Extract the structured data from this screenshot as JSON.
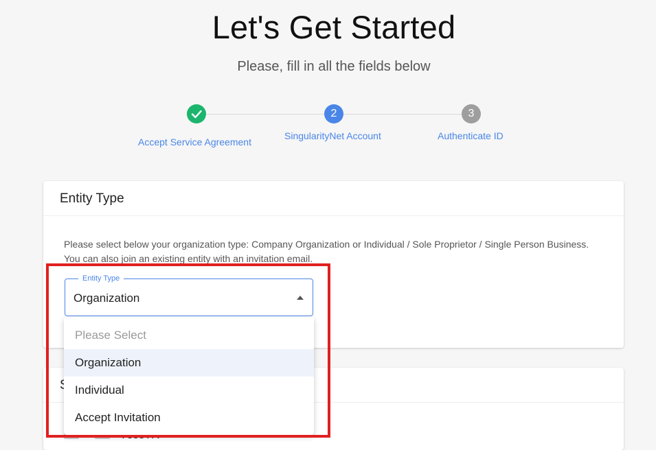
{
  "header": {
    "title": "Let's Get Started",
    "subtitle": "Please, fill in all the fields below"
  },
  "stepper": {
    "steps": [
      {
        "label": "Accept Service Agreement",
        "number": "",
        "state": "completed",
        "icon": "check-icon",
        "color": "#1cb56d"
      },
      {
        "label": "SingularityNet Account",
        "number": "2",
        "state": "active",
        "color": "#4a86e8"
      },
      {
        "label": "Authenticate ID",
        "number": "3",
        "state": "pending",
        "color": "#9e9e9e"
      }
    ]
  },
  "entity_card": {
    "title": "Entity Type",
    "description_line1": "Please select below your organization type: Company Organization or Individual / Sole Proprietor / Single Person Business.",
    "description_line2": "You can also join an existing entity with an invitation email.",
    "select": {
      "label": "Entity Type",
      "value": "Organization",
      "options": [
        "Please Select",
        "Organization",
        "Individual",
        "Accept Invitation"
      ],
      "placeholder_index": 0,
      "selected_index": 1
    }
  },
  "second_card": {
    "title_partial": "S",
    "content_partial": "?cco?r?"
  },
  "colors": {
    "accent": "#4a86e8",
    "success": "#1cb56d",
    "highlight_border": "#e02020"
  }
}
